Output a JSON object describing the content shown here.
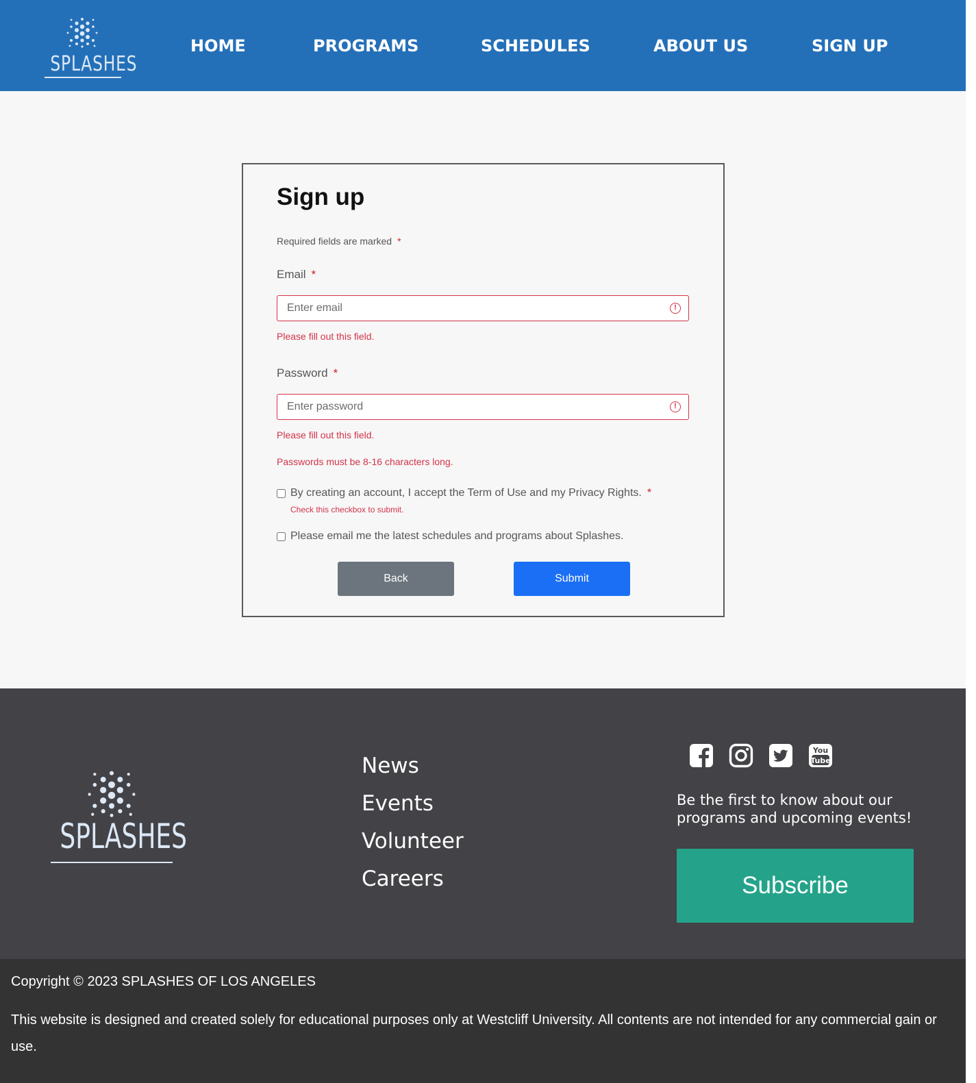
{
  "brand": {
    "logo_text": "SPLASHES",
    "primary": "#2470b8"
  },
  "nav": {
    "items": [
      {
        "label": "HOME"
      },
      {
        "label": "PROGRAMS"
      },
      {
        "label": "SCHEDULES"
      },
      {
        "label": "ABOUT US"
      },
      {
        "label": "SIGN UP"
      }
    ]
  },
  "form": {
    "title": "Sign up",
    "required_note": "Required fields are marked",
    "required_mark": "*",
    "email": {
      "label": "Email",
      "placeholder": "Enter email",
      "value": "",
      "error": "Please fill out this field."
    },
    "password": {
      "label": "Password",
      "placeholder": "Enter password",
      "value": "",
      "error": "Please fill out this field.",
      "length_error": "Passwords must be 8-16 characters long."
    },
    "terms": {
      "label": "By creating an account, I accept the Term of Use and my Privacy Rights.",
      "checked": false,
      "error": "Check this checkbox to submit."
    },
    "newsletter": {
      "label": "Please email me the latest schedules and programs about Splashes.",
      "checked": false
    },
    "back_label": "Back",
    "submit_label": "Submit",
    "error_color": "#d2334a"
  },
  "footer": {
    "logo_text": "SPLASHES",
    "links": [
      {
        "label": "News"
      },
      {
        "label": "Events"
      },
      {
        "label": "Volunteer"
      },
      {
        "label": "Careers"
      }
    ],
    "social": [
      "facebook-icon",
      "instagram-icon",
      "twitter-icon",
      "youtube-icon"
    ],
    "tagline": "Be the first to know about our programs and upcoming events!",
    "subscribe_label": "Subscribe",
    "subscribe_color": "#24a38a"
  },
  "bottom": {
    "copyright": "Copyright © 2023 SPLASHES OF LOS ANGELES",
    "disclaimer": "This website is designed and created solely for educational purposes only at Westcliff University. All contents are not intended for any commercial gain or use."
  }
}
